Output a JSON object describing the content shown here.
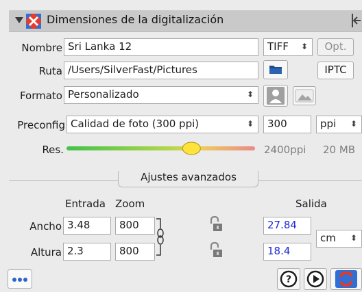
{
  "header": {
    "title": "Dimensiones de la digitalización"
  },
  "row_nombre": {
    "label": "Nombre",
    "value": "Sri Lanka 12",
    "format": "TIFF",
    "opt_label": "Opt."
  },
  "row_ruta": {
    "label": "Ruta",
    "value": "/Users/SilverFast/Pictures",
    "iptc_label": "IPTC"
  },
  "row_formato": {
    "label": "Formato",
    "value": "Personalizado"
  },
  "row_preconfig": {
    "label": "Preconfig",
    "value": "Calidad de foto (300 ppi)",
    "resolution": "300",
    "unit": "ppi"
  },
  "row_res": {
    "label": "Res.",
    "ppi_readout": "2400ppi",
    "size_readout": "20 MB",
    "slider_level": 0.68
  },
  "advanced": {
    "title": "Ajustes avanzados",
    "col_entrada": "Entrada",
    "col_zoom": "Zoom",
    "col_salida": "Salida",
    "ancho_label": "Ancho",
    "ancho_in": "3.48",
    "ancho_zoom": "800",
    "ancho_out": "27.84",
    "altura_label": "Altura",
    "altura_in": "2.3",
    "altura_zoom": "800",
    "altura_out": "18.4",
    "out_unit": "cm"
  },
  "colors": {
    "accent_blue": "#1a28d8",
    "reset_red": "#e23a2a"
  },
  "icons": [
    "disclosure-triangle-icon",
    "scan-frame-icon",
    "exit-icon",
    "folder-icon",
    "portrait-icon",
    "landscape-icon",
    "lock-icon",
    "chain-link-icon",
    "more-icon",
    "help-icon",
    "play-icon",
    "reset-icon"
  ]
}
